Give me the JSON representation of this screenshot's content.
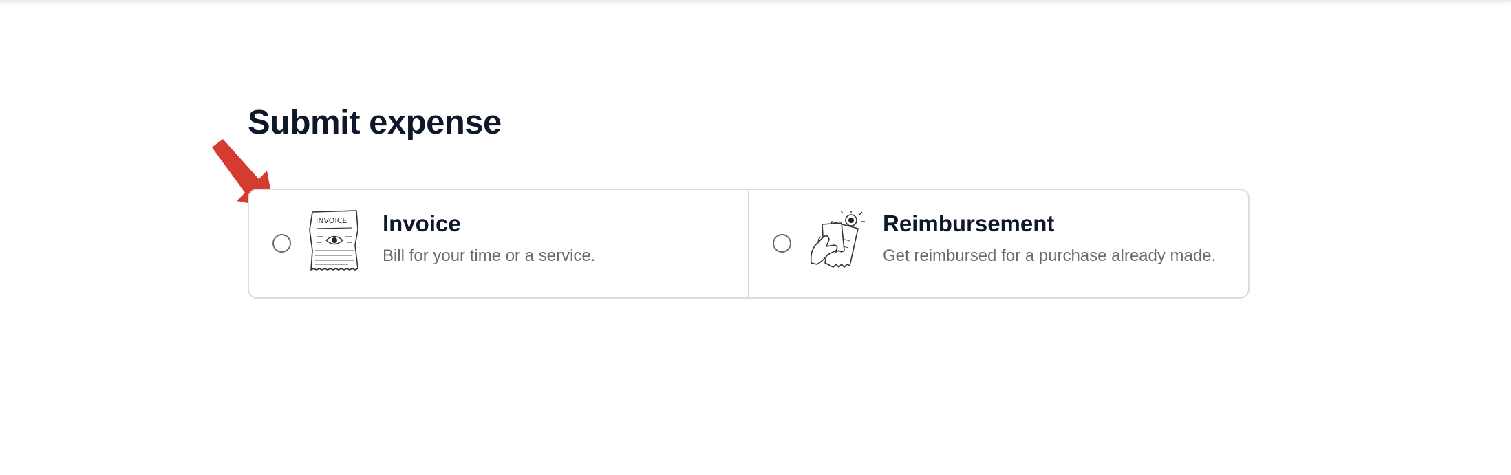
{
  "page": {
    "title": "Submit expense"
  },
  "expense_types": [
    {
      "title": "Invoice",
      "description": "Bill for your time or a service.",
      "illustration_icon": "invoice-document-icon",
      "illustration_text": "INVOICE",
      "selected": false
    },
    {
      "title": "Reimbursement",
      "description": "Get reimbursed for a purchase already made.",
      "illustration_icon": "hand-holding-receipts-icon",
      "selected": false
    }
  ],
  "annotation": {
    "icon": "red-arrow-icon",
    "color": "#d63b2f"
  },
  "colors": {
    "title_text": "#0f172a",
    "muted_text": "#6b6b6b",
    "border": "#dcdcdc"
  }
}
